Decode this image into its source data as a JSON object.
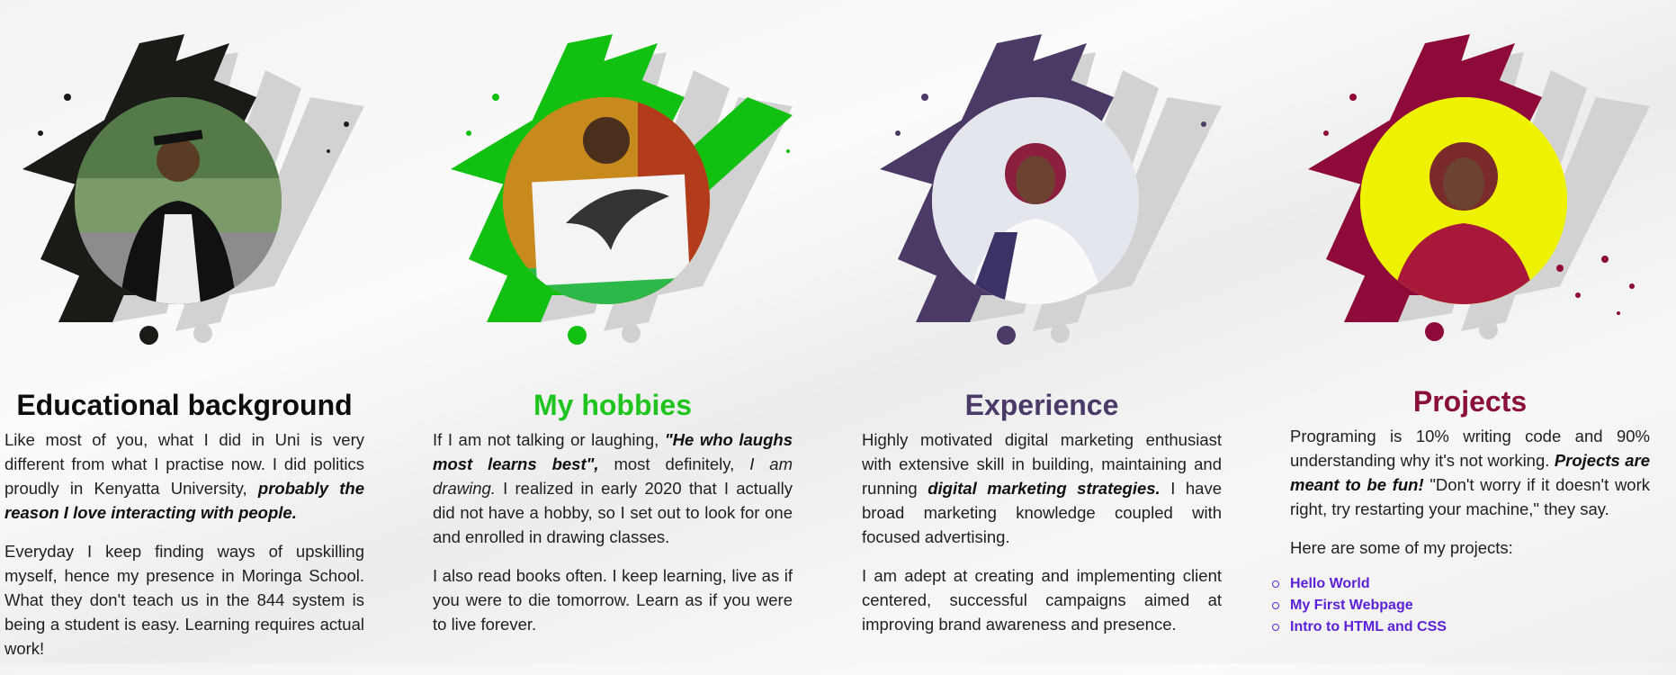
{
  "sections": [
    {
      "id": "education",
      "title": "Educational background",
      "color": "#0d0d0d",
      "accent": "#1a1a17",
      "photo_bg": "#6f8c5c",
      "p1_a": "Like most of you, what I did in Uni is very different from what I practise now. I did politics proudly in Kenyatta University, ",
      "p1_b": "probably the reason I love interacting with people.",
      "p2": "Everyday I keep finding ways of upskilling myself, hence my presence in Moringa School. What they don't teach us in the 844 system is being a student is easy. Learning requires actual work!"
    },
    {
      "id": "hobbies",
      "title": "My hobbies",
      "color": "#1fc41f",
      "accent": "#11c011",
      "photo_bg": "#c98a1d",
      "p1_a": "If I am not talking or laughing, ",
      "p1_b": "\"He who laughs most learns best\",",
      "p1_c": " most definitely, ",
      "p1_d": "I am drawing.",
      "p1_e": " I realized in early 2020 that I actually did not have a hobby, so I set out to look for one and enrolled in drawing classes.",
      "p2": "I also read books often. I keep learning, live as if you were to die tomorrow. Learn as if you were to live forever."
    },
    {
      "id": "experience",
      "title": "Experience",
      "color": "#4b3a68",
      "accent": "#4b3a66",
      "photo_bg": "#e4e6ee",
      "p1_a": "Highly motivated digital marketing enthusiast with extensive skill in building, maintaining and running ",
      "p1_b": "digital marketing strategies.",
      "p1_c": " I have broad marketing knowledge coupled with focused advertising.",
      "p2": "I am adept at creating and implementing client centered, successful campaigns aimed at improving brand awareness and presence."
    },
    {
      "id": "projects",
      "title": "Projects",
      "color": "#8a0f3a",
      "accent": "#8d0a3a",
      "photo_bg": "#eef200",
      "p1_a": "Programing is 10% writing code and 90% understanding why it's not working. ",
      "p1_b": "Projects are meant to be fun!",
      "p1_c": " \"Don't worry if it doesn't work right, try restarting your machine,\" they say.",
      "p2": "Here are some of my projects:",
      "links": [
        "Hello World",
        "My First Webpage",
        "Intro to HTML and CSS"
      ],
      "link_color": "#5b1fd6"
    }
  ]
}
